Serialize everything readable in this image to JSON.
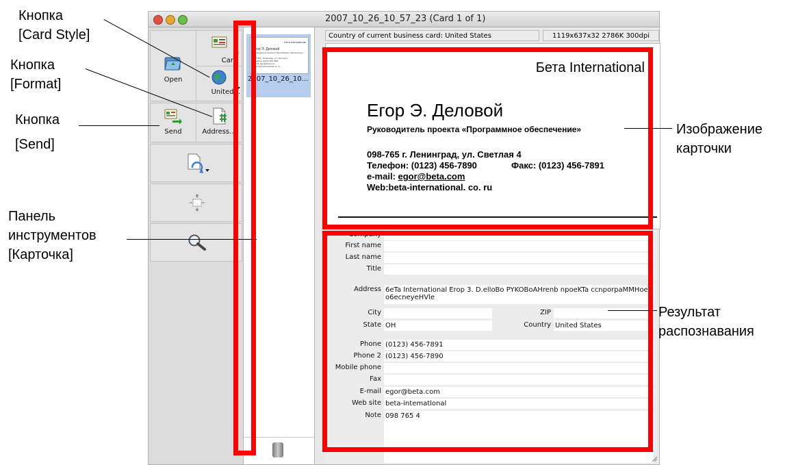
{
  "window": {
    "title": "2007_10_26_10_57_23 (Card 1 of 1)"
  },
  "toolbar": {
    "open_label": "Open",
    "card_style_label": "Card",
    "format_label": "United...",
    "send_label": "Send",
    "address_label": "Address..."
  },
  "thumbnails": {
    "items": [
      {
        "label": "2007_10_26_10...",
        "selected": true
      }
    ]
  },
  "info": {
    "country": "Country of current business card: United States",
    "image_info": "1119x637x32  2786K  300dpi"
  },
  "card": {
    "company": "Бета International",
    "name": "Егор Э. Деловой",
    "position": "Руководитель проекта «Программное обеспечение»",
    "address": "098-765 г. Ленинград, ул. Светлая 4",
    "phone": "Телефон: (0123) 456-7890",
    "fax": "Факс: (0123) 456-7891",
    "email_prefix": "e-mail: ",
    "email": "egor@beta.com",
    "web": "Web:beta-international. co. ru",
    "thumb_lines": [
      "Бета International",
      "Егор Э. Деловой",
      "Руководитель проекта «Программное обеспечение»",
      "098-765 г. Ленинград, ул. Светлая 4",
      "Телефон: (0123) 456-7890",
      "e-mail: egor@beta.com",
      "Web:beta-international. co. ru"
    ]
  },
  "form": {
    "company_label": "Company",
    "first_name_label": "First name",
    "first_name": "",
    "last_name_label": "Last name",
    "last_name": "",
    "title_label": "Title",
    "title": "",
    "address_label": "Address",
    "address_line1": "6eTa International Erop 3. D.elloBo  PYKOBoAHrenb npoeKTa ccnporpaMMHoe",
    "address_line2": "o6ecneyeHVle",
    "city_label": "City",
    "city": "",
    "zip_label": "ZIP",
    "zip": "",
    "state_label": "State",
    "state": "OH",
    "country_label": "Country",
    "country": "United States",
    "phone_label": "Phone",
    "phone": "(0123) 456-7891",
    "phone2_label": "Phone 2",
    "phone2": "(0123) 456-7890",
    "mobile_label": "Mobile phone",
    "mobile": "",
    "fax_label": "Fax",
    "fax": "",
    "email_label": "E-mail",
    "email": "egor@beta.com",
    "website_label": "Web site",
    "website": "beta-intematlonal",
    "note_label": "Note",
    "note": "098 765   4"
  },
  "callouts": {
    "card_style_1": "Кнопка",
    "card_style_2": "[Card Style]",
    "format_1": "Кнопка",
    "format_2": "[Format]",
    "send_1": "Кнопка",
    "send_2": "[Send]",
    "toolbar_1": "Панель",
    "toolbar_2": "инструментов",
    "toolbar_3": "[Карточка]",
    "image_1": "Изображение",
    "image_2": "карточки",
    "result_1": "Результат",
    "result_2": "распознавания"
  },
  "colors": {
    "highlight": "#ff0000",
    "selection": "#b7cdee"
  }
}
